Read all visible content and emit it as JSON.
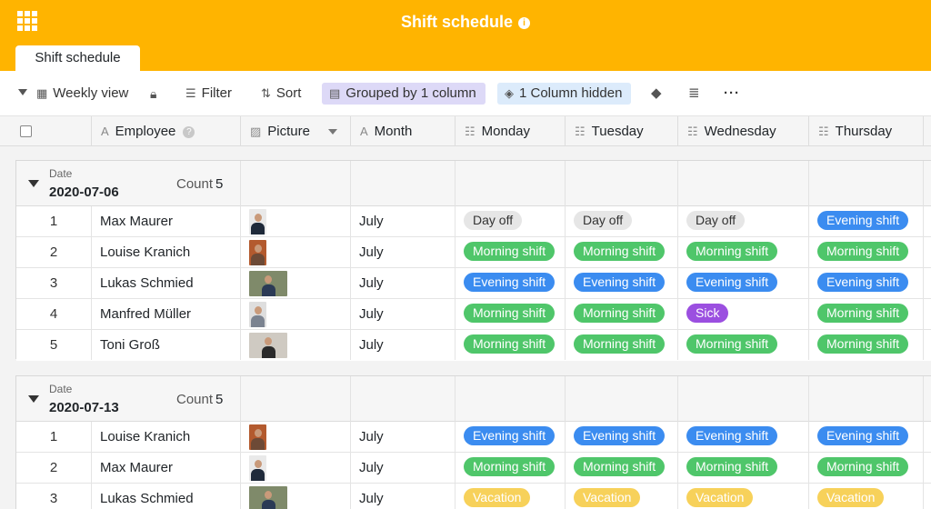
{
  "app": {
    "title": "Shift schedule",
    "tab_label": "Shift schedule"
  },
  "toolbar": {
    "view_label": "Weekly view",
    "filter_label": "Filter",
    "sort_label": "Sort",
    "group_label": "Grouped by 1 column",
    "hidden_label": "1 Column hidden"
  },
  "columns": {
    "employee": "Employee",
    "picture": "Picture",
    "month": "Month",
    "monday": "Monday",
    "tuesday": "Tuesday",
    "wednesday": "Wednesday",
    "thursday": "Thursday"
  },
  "colors": {
    "header": "#ffb400",
    "day_off": "#e6e6e6",
    "morning_shift": "#4fc66a",
    "evening_shift": "#3b8cf0",
    "sick": "#9b4fe0",
    "vacation": "#f7d15a"
  },
  "groups": [
    {
      "field_label": "Date",
      "value": "2020-07-06",
      "count_label": "Count",
      "count": "5",
      "rows": [
        {
          "index": "1",
          "employee": "Max Maurer",
          "month": "July",
          "monday": "Day off",
          "tuesday": "Day off",
          "wednesday": "Day off",
          "thursday": "Evening shift"
        },
        {
          "index": "2",
          "employee": "Louise Kranich",
          "month": "July",
          "monday": "Morning shift",
          "tuesday": "Morning shift",
          "wednesday": "Morning shift",
          "thursday": "Morning shift"
        },
        {
          "index": "3",
          "employee": "Lukas Schmied",
          "month": "July",
          "monday": "Evening shift",
          "tuesday": "Evening shift",
          "wednesday": "Evening shift",
          "thursday": "Evening shift"
        },
        {
          "index": "4",
          "employee": "Manfred Müller",
          "month": "July",
          "monday": "Morning shift",
          "tuesday": "Morning shift",
          "wednesday": "Sick",
          "thursday": "Morning shift"
        },
        {
          "index": "5",
          "employee": "Toni Groß",
          "month": "July",
          "monday": "Morning shift",
          "tuesday": "Morning shift",
          "wednesday": "Morning shift",
          "thursday": "Morning shift"
        }
      ]
    },
    {
      "field_label": "Date",
      "value": "2020-07-13",
      "count_label": "Count",
      "count": "5",
      "rows": [
        {
          "index": "1",
          "employee": "Louise Kranich",
          "month": "July",
          "monday": "Evening shift",
          "tuesday": "Evening shift",
          "wednesday": "Evening shift",
          "thursday": "Evening shift"
        },
        {
          "index": "2",
          "employee": "Max Maurer",
          "month": "July",
          "monday": "Morning shift",
          "tuesday": "Morning shift",
          "wednesday": "Morning shift",
          "thursday": "Morning shift"
        },
        {
          "index": "3",
          "employee": "Lukas Schmied",
          "month": "July",
          "monday": "Vacation",
          "tuesday": "Vacation",
          "wednesday": "Vacation",
          "thursday": "Vacation"
        }
      ]
    }
  ]
}
